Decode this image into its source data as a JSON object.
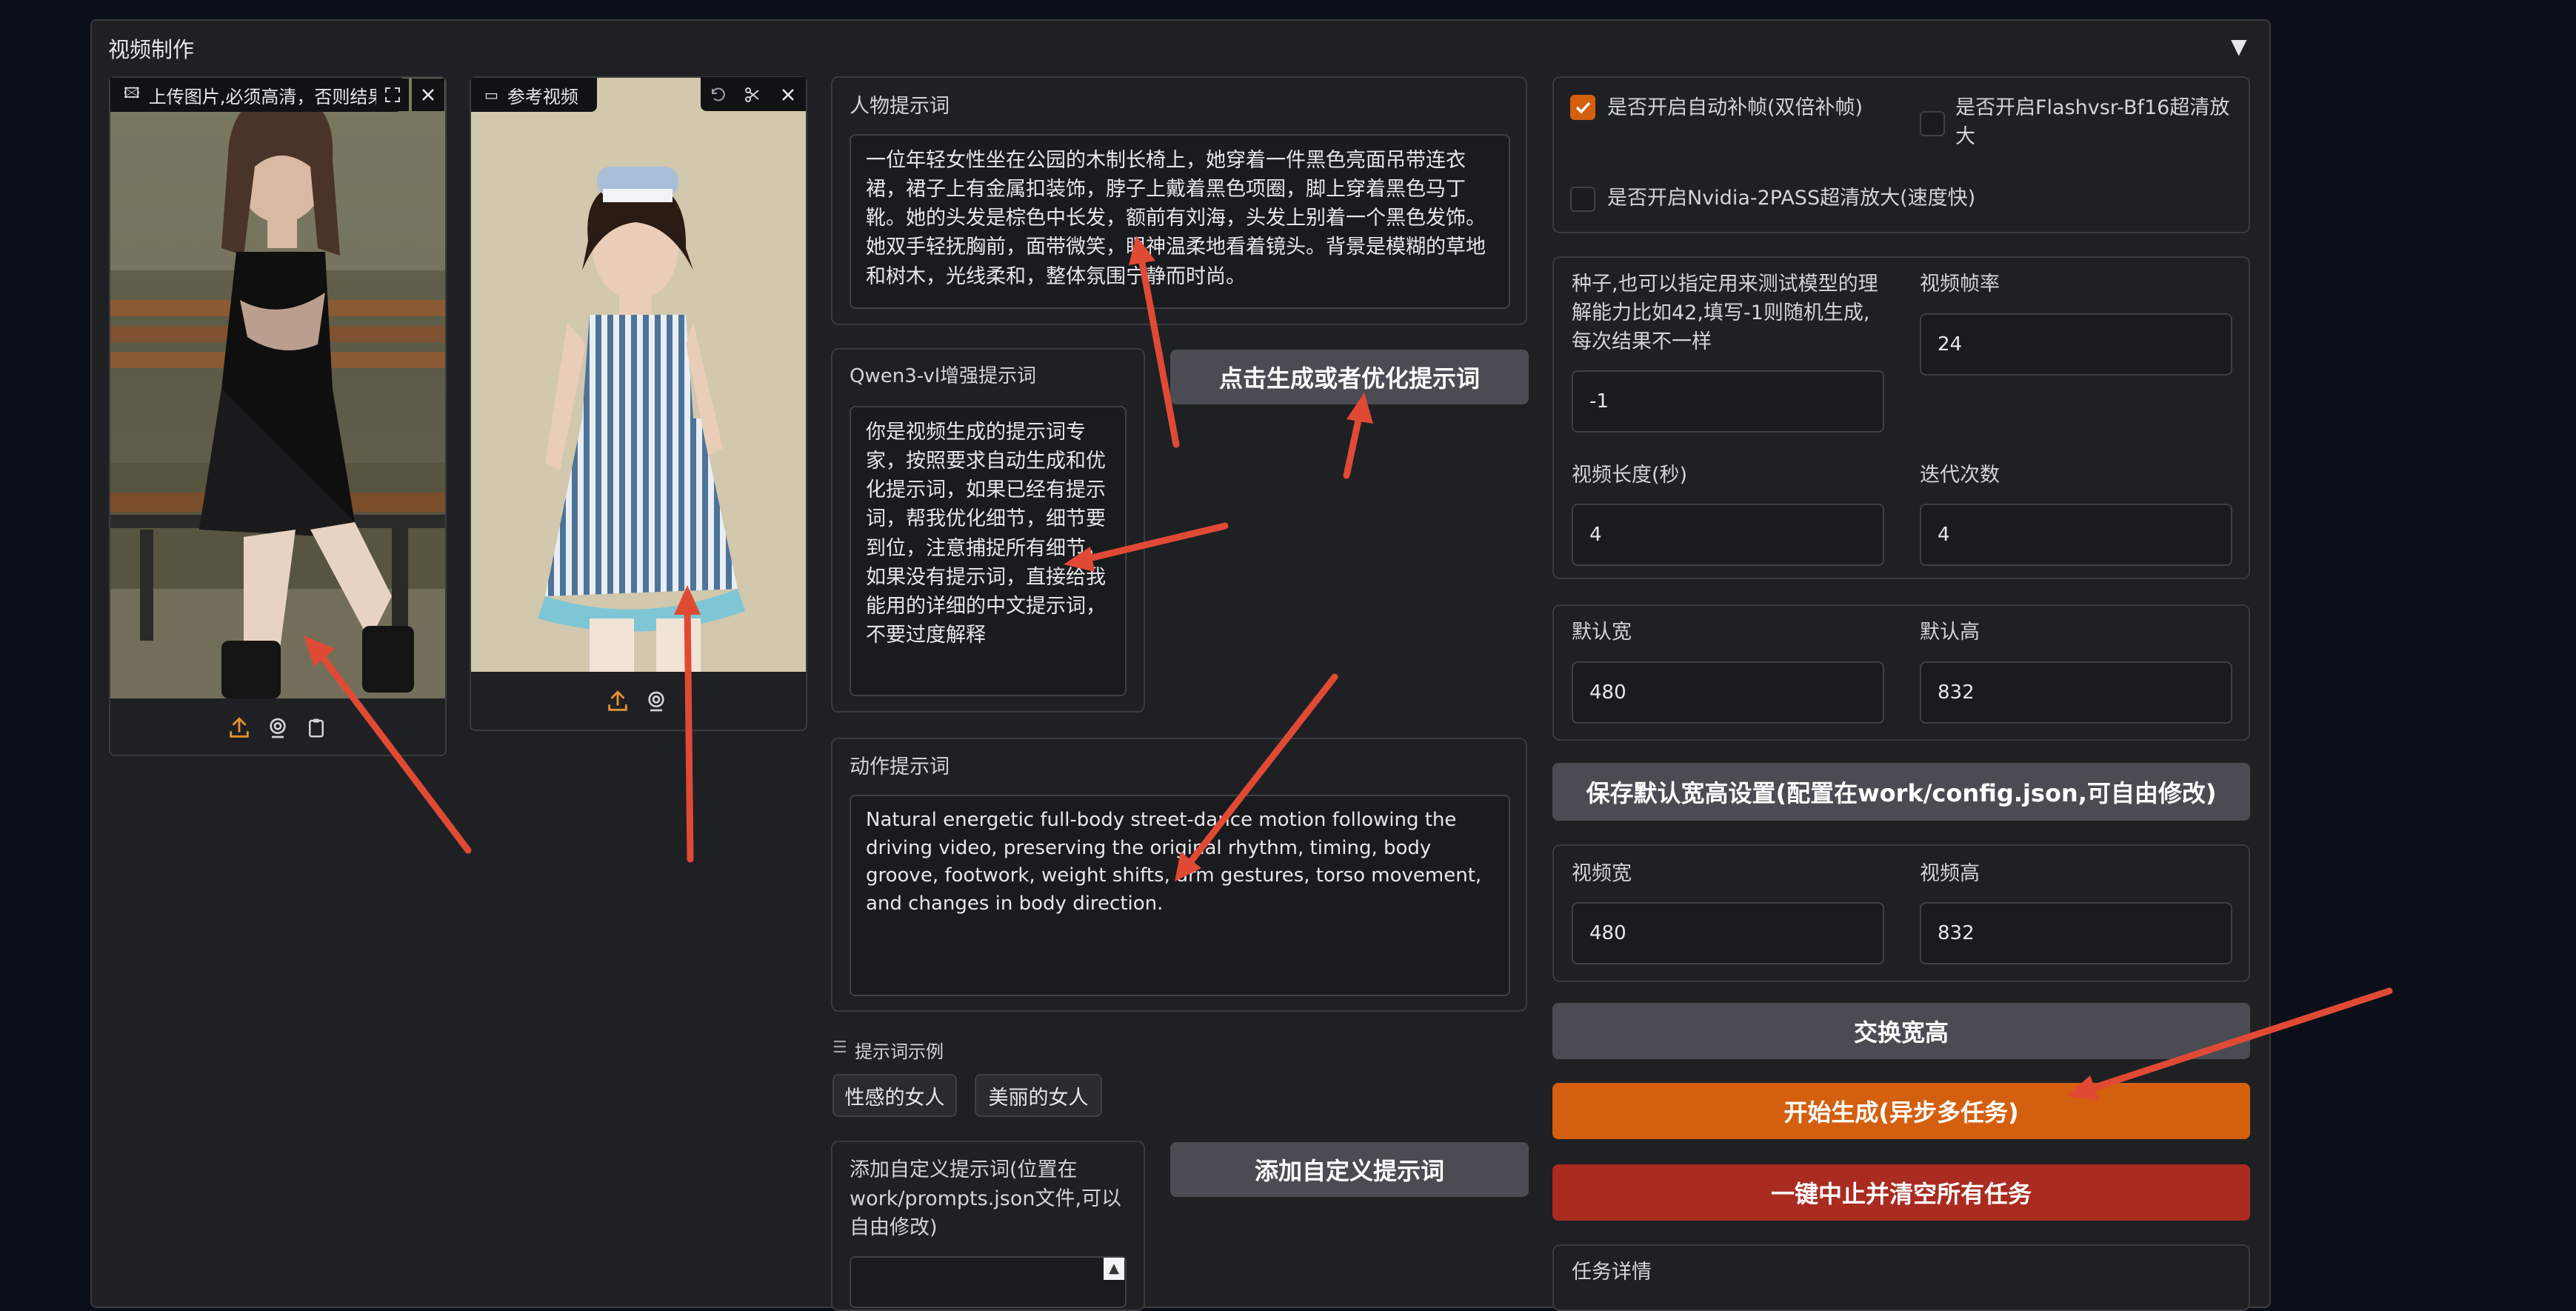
{
  "accordion": {
    "title": "视频制作",
    "toggle": "▼"
  },
  "upload_image": {
    "label": "上传图片,必须高清，否则结果"
  },
  "ref_video": {
    "label": "参考视频"
  },
  "person_prompt": {
    "label": "人物提示词",
    "value": "一位年轻女性坐在公园的木制长椅上，她穿着一件黑色亮面吊带连衣裙，裙子上有金属扣装饰，脖子上戴着黑色项圈，脚上穿着黑色马丁靴。她的头发是棕色中长发，额前有刘海，头发上别着一个黑色发饰。她双手轻抚胸前，面带微笑，眼神温柔地看着镜头。背景是模糊的草地和树木，光线柔和，整体氛围宁静而时尚。"
  },
  "qwen_prompt": {
    "label": "Qwen3-vl增强提示词",
    "value": "你是视频生成的提示词专家，按照要求自动生成和优化提示词，如果已经有提示词，帮我优化细节，细节要到位，注意捕捉所有细节，如果没有提示词，直接给我能用的详细的中文提示词，不要过度解释"
  },
  "gen_prompt_button": "点击生成或者优化提示词",
  "action_prompt": {
    "label": "动作提示词",
    "value": "Natural energetic full-body street-dance motion following the driving video, preserving the original rhythm, timing, body groove, footwork, weight shifts, arm gestures, torso movement, and changes in body direction."
  },
  "examples": {
    "label": "提示词示例",
    "items": [
      "性感的女人",
      "美丽的女人"
    ]
  },
  "custom_prompt": {
    "label": "添加自定义提示词(位置在work/prompts.json文件,可以自由修改)"
  },
  "add_custom_button": "添加自定义提示词",
  "options": {
    "auto_interp": {
      "label": "是否开启自动补帧(双倍补帧)",
      "checked": true
    },
    "flashvsr": {
      "label": "是否开启Flashvsr-Bf16超清放大",
      "checked": false
    },
    "nvidia": {
      "label": "是否开启Nvidia-2PASS超清放大(速度快)",
      "checked": false
    }
  },
  "seed": {
    "label": "种子,也可以指定用来测试模型的理解能力比如42,填写-1则随机生成,每次结果不一样",
    "value": "-1"
  },
  "fps": {
    "label": "视频帧率",
    "value": "24"
  },
  "duration": {
    "label": "视频长度(秒)",
    "value": "4"
  },
  "iterations": {
    "label": "迭代次数",
    "value": "4"
  },
  "default_w": {
    "label": "默认宽",
    "value": "480"
  },
  "default_h": {
    "label": "默认高",
    "value": "832"
  },
  "save_defaults_button": "保存默认宽高设置(配置在work/config.json,可自由修改)",
  "video_w": {
    "label": "视频宽",
    "value": "480"
  },
  "video_h": {
    "label": "视频高",
    "value": "832"
  },
  "swap_button": "交换宽高",
  "start_button": "开始生成(异步多任务)",
  "stop_button": "一键中止并清空所有任务",
  "task_details": {
    "label": "任务详情"
  },
  "colors": {
    "accent": "#d45f0e",
    "danger": "#aa2b20",
    "annotation": "#e04a35"
  }
}
